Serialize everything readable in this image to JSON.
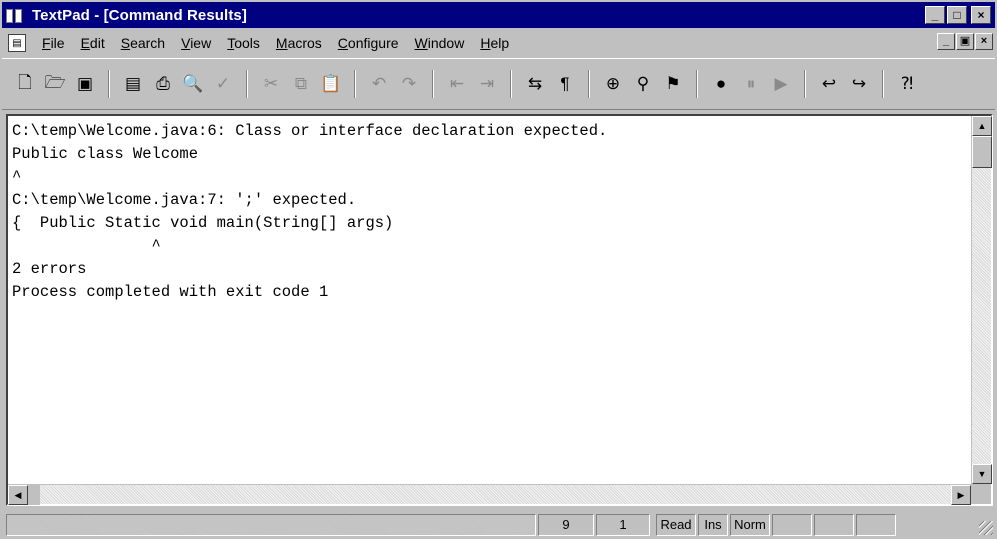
{
  "window": {
    "title": "TextPad - [Command Results]",
    "app_icon": "textpad-app-icon",
    "controls": {
      "minimize": "_",
      "maximize": "□",
      "close": "×"
    }
  },
  "menubar": {
    "items": [
      "File",
      "Edit",
      "Search",
      "View",
      "Tools",
      "Macros",
      "Configure",
      "Window",
      "Help"
    ],
    "mdi_controls": {
      "minimize": "_",
      "restore": "▣",
      "close": "×"
    }
  },
  "toolbar": {
    "buttons": [
      {
        "icon": "new-file-icon",
        "glyph": "🗋"
      },
      {
        "icon": "open-file-icon",
        "glyph": "🗁"
      },
      {
        "icon": "save-icon",
        "glyph": "▣"
      },
      {
        "sep": true
      },
      {
        "icon": "document-properties-icon",
        "glyph": "▤"
      },
      {
        "icon": "print-icon",
        "glyph": "⎙"
      },
      {
        "icon": "print-preview-icon",
        "glyph": "🔍"
      },
      {
        "icon": "spell-check-icon",
        "glyph": "✓",
        "dim": true
      },
      {
        "sep": true
      },
      {
        "icon": "cut-icon",
        "glyph": "✂",
        "dim": true
      },
      {
        "icon": "copy-icon",
        "glyph": "⧉",
        "dim": true
      },
      {
        "icon": "paste-icon",
        "glyph": "📋",
        "dim": true
      },
      {
        "sep": true
      },
      {
        "icon": "undo-icon",
        "glyph": "↶",
        "dim": true
      },
      {
        "icon": "redo-icon",
        "glyph": "↷",
        "dim": true
      },
      {
        "sep": true
      },
      {
        "icon": "indent-icon",
        "glyph": "⇤",
        "dim": true
      },
      {
        "icon": "outdent-icon",
        "glyph": "⇥",
        "dim": true
      },
      {
        "sep": true
      },
      {
        "icon": "word-wrap-icon",
        "glyph": "⇆"
      },
      {
        "icon": "pilcrow-icon",
        "glyph": "¶"
      },
      {
        "sep": true
      },
      {
        "icon": "find-icon",
        "glyph": "⊕"
      },
      {
        "icon": "find-next-icon",
        "glyph": "⚲"
      },
      {
        "icon": "replace-icon",
        "glyph": "⚑"
      },
      {
        "sep": true
      },
      {
        "icon": "record-macro-icon",
        "glyph": "●"
      },
      {
        "icon": "pause-macro-icon",
        "glyph": "⏸",
        "dim": true
      },
      {
        "icon": "play-macro-icon",
        "glyph": "▶",
        "dim": true
      },
      {
        "sep": true
      },
      {
        "icon": "previous-document-icon",
        "glyph": "↩"
      },
      {
        "icon": "next-document-icon",
        "glyph": "↪"
      },
      {
        "sep": true
      },
      {
        "icon": "context-help-icon",
        "glyph": "⁈"
      }
    ]
  },
  "output": {
    "lines": [
      "C:\\temp\\Welcome.java:6: Class or interface declaration expected.",
      "Public class Welcome",
      "^",
      "C:\\temp\\Welcome.java:7: ';' expected.",
      "{  Public Static void main(String[] args)",
      "               ^",
      "2 errors",
      "Process completed with exit code 1"
    ]
  },
  "scrollbars": {
    "up_arrow": "▲",
    "down_arrow": "▼",
    "left_arrow": "◀",
    "right_arrow": "▶"
  },
  "statusbar": {
    "line": "9",
    "column": "1",
    "read_mode": "Read",
    "insert_mode": "Ins",
    "line_ending": "Norm"
  }
}
